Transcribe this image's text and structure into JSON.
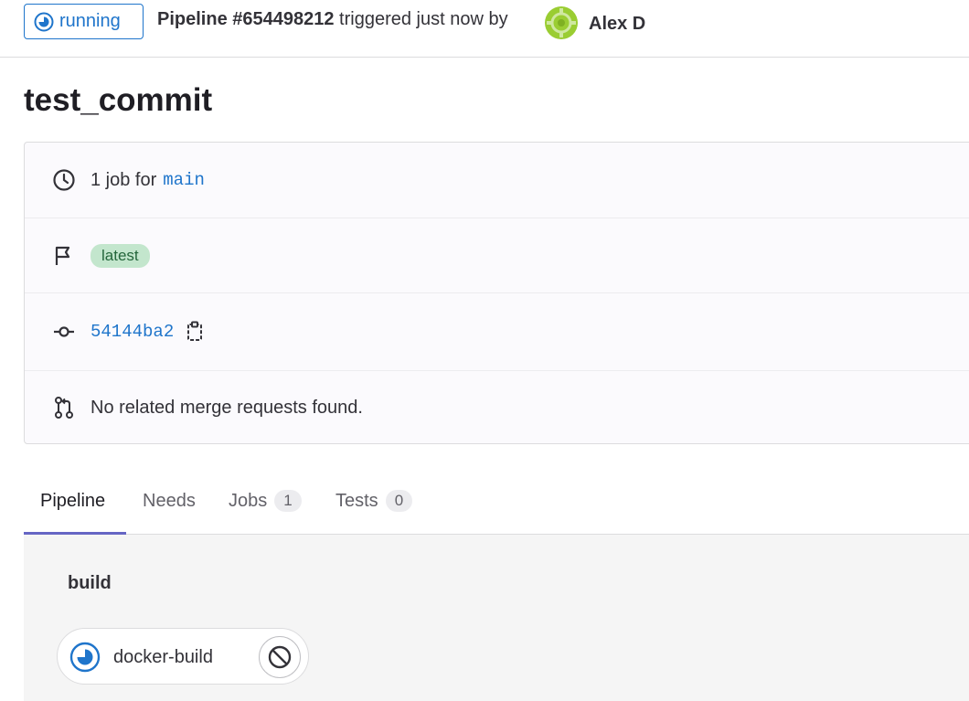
{
  "header": {
    "status": "running",
    "pipeline_id": "Pipeline #654498212",
    "trigger_text": "triggered just now by",
    "user_name": "Alex D",
    "avatar_icon": "user-avatar-icon",
    "status_color": "#1f75cb"
  },
  "commit": {
    "title": "test_commit"
  },
  "info": {
    "jobs_prefix": "1 job for",
    "branch": "main",
    "tag": "latest",
    "sha": "54144ba2",
    "merge_requests": "No related merge requests found.",
    "icons": [
      "clock-icon",
      "flag-icon",
      "commit-icon",
      "merge-request-icon",
      "copy-icon"
    ]
  },
  "tabs": [
    {
      "label": "Pipeline",
      "active": true
    },
    {
      "label": "Needs"
    },
    {
      "label": "Jobs",
      "count": "1"
    },
    {
      "label": "Tests",
      "count": "0"
    }
  ],
  "graph": {
    "stage": "build",
    "job": {
      "name": "docker-build",
      "status": "running",
      "action_icon": "cancel-icon"
    }
  }
}
